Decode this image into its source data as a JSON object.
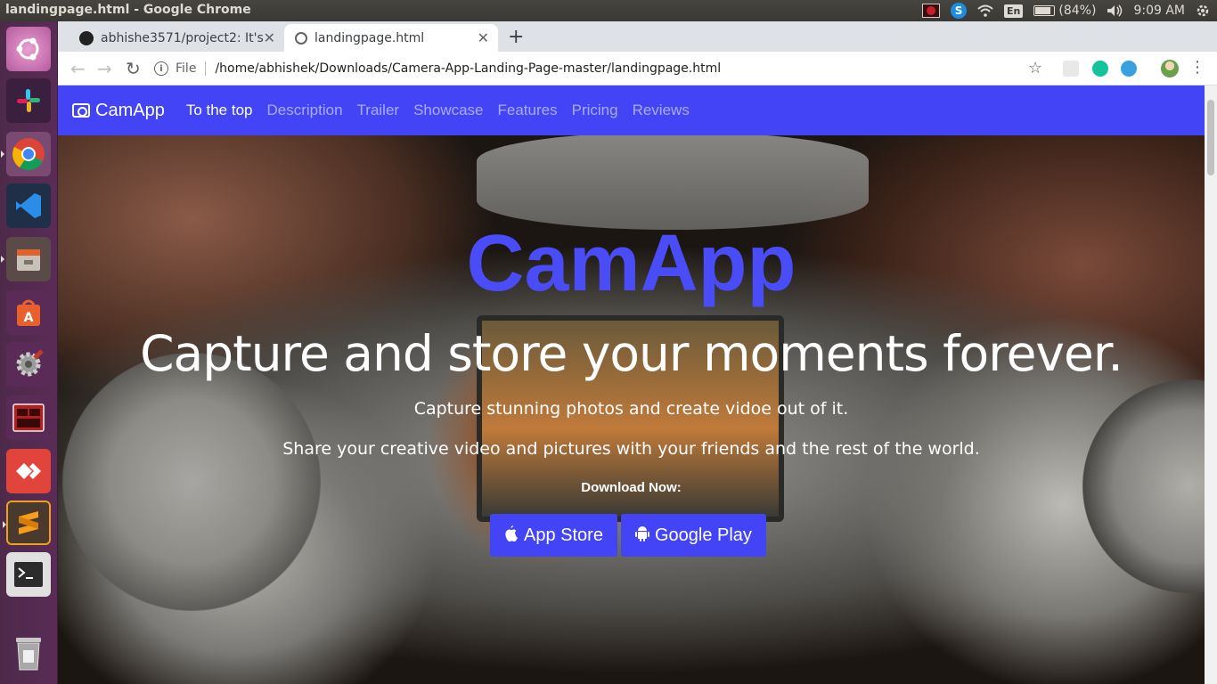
{
  "os": {
    "window_title": "landingpage.html - Google Chrome",
    "battery": "(84%)",
    "keyboard": "En",
    "clock": "9:09 AM",
    "launcher_items": [
      "ubuntu-dash",
      "slack",
      "chrome",
      "vscode",
      "files",
      "software-center",
      "settings",
      "terminal-app",
      "anydesk",
      "sublime-text",
      "terminal",
      "trash"
    ]
  },
  "browser": {
    "tabs": [
      {
        "label": "abhishe3571/project2: It's"
      },
      {
        "label": "landingpage.html"
      }
    ],
    "new_tab": "+",
    "url_scheme_label": "File",
    "url": "/home/abhishek/Downloads/Camera-App-Landing-Page-master/landingpage.html"
  },
  "site": {
    "brand": "CamApp",
    "nav": [
      "To the top",
      "Description",
      "Trailer",
      "Showcase",
      "Features",
      "Pricing",
      "Reviews"
    ],
    "hero_title": "CamApp",
    "tagline": "Capture and store your moments forever.",
    "sub1": "Capture stunning photos and create vidoe out of it.",
    "sub2": "Share your creative video and pictures with your friends and the rest of the world.",
    "download_label": "Download Now:",
    "app_store": "App Store",
    "google_play": "Google Play",
    "accent_color": "#4344f6"
  }
}
